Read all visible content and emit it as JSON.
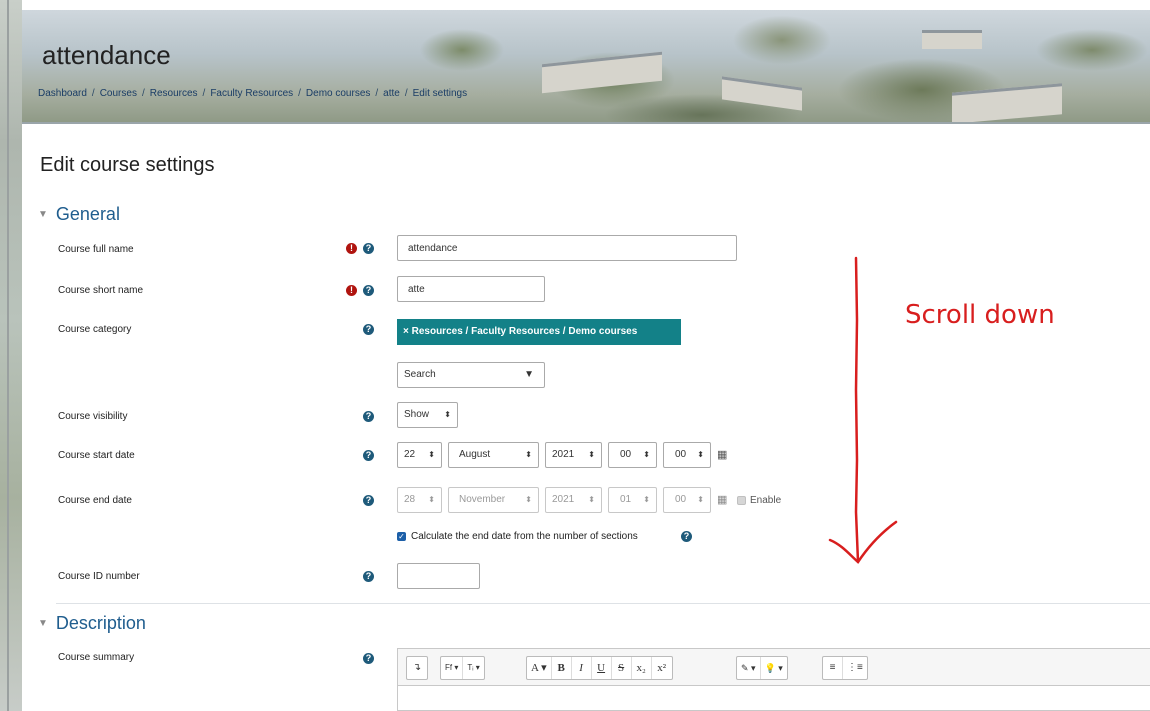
{
  "header": {
    "page_title": "attendance",
    "breadcrumb": [
      "Dashboard",
      "Courses",
      "Resources",
      "Faculty Resources",
      "Demo courses",
      "atte",
      "Edit settings"
    ]
  },
  "main": {
    "heading": "Edit course settings"
  },
  "sections": {
    "general": "General",
    "description": "Description"
  },
  "fields": {
    "full_name": {
      "label": "Course full name",
      "value": "attendance"
    },
    "short_name": {
      "label": "Course short name",
      "value": "atte"
    },
    "category": {
      "label": "Course category",
      "selected": "× Resources / Faculty Resources / Demo courses",
      "search_placeholder": "Search"
    },
    "visibility": {
      "label": "Course visibility",
      "value": "Show"
    },
    "start_date": {
      "label": "Course start date",
      "day": "22",
      "month": "August",
      "year": "2021",
      "hour": "00",
      "minute": "00"
    },
    "end_date": {
      "label": "Course end date",
      "day": "28",
      "month": "November",
      "year": "2021",
      "hour": "01",
      "minute": "00",
      "enable_label": "Enable",
      "enabled": false
    },
    "calculate_end_date": {
      "label": "Calculate the end date from the number of sections",
      "checked": true
    },
    "id_number": {
      "label": "Course ID number",
      "value": ""
    },
    "summary": {
      "label": "Course summary"
    }
  },
  "editor_toolbar": {
    "groups": [
      [
        "↴"
      ],
      [
        "Ff ▾",
        "Tᵢ ▾"
      ],
      [
        "A ▾",
        "B",
        "I",
        "U",
        "S",
        "x₂",
        "x²"
      ],
      [
        "✎ ▾",
        "💡 ▾"
      ],
      [
        "≡",
        "⋮≡"
      ]
    ]
  },
  "annotation": {
    "text": "Scroll down"
  },
  "icons": {
    "required": "exclamation-circle-icon",
    "help": "question-circle-icon",
    "calendar": "calendar-icon"
  },
  "colors": {
    "accent_teal": "#138188",
    "link_blue": "#1f5d8e",
    "required_red": "#b0140f",
    "annotation_red": "#d81e1e"
  }
}
